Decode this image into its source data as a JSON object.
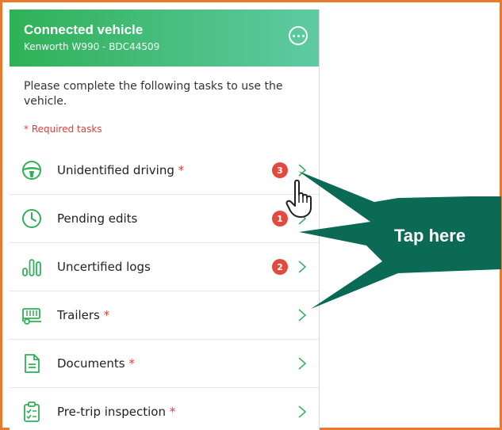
{
  "header": {
    "title": "Connected vehicle",
    "subtitle": "Kenworth W990 - BDC44509",
    "menu_icon": "more-horizontal-icon"
  },
  "intro": "Please complete the following tasks to use the vehicle.",
  "required_note": "* Required tasks",
  "tasks": [
    {
      "label": "Unidentified driving",
      "required": "*",
      "badge": "3",
      "icon": "steering-wheel-icon"
    },
    {
      "label": "Pending edits",
      "required": "",
      "badge": "1",
      "icon": "clock-icon"
    },
    {
      "label": "Uncertified logs",
      "required": "",
      "badge": "2",
      "icon": "bar-chart-icon"
    },
    {
      "label": "Trailers",
      "required": "*",
      "badge": "",
      "icon": "trailer-icon"
    },
    {
      "label": "Documents",
      "required": "*",
      "badge": "",
      "icon": "document-icon"
    },
    {
      "label": "Pre-trip inspection",
      "required": "*",
      "badge": "",
      "icon": "clipboard-icon"
    }
  ],
  "callout": {
    "text": "Tap here"
  },
  "colors": {
    "accent_green": "#2fb157",
    "badge_red": "#e14a3c",
    "required_red": "#e03b3b",
    "callout_green": "#0b6a55",
    "frame_orange": "#e97a2b"
  }
}
